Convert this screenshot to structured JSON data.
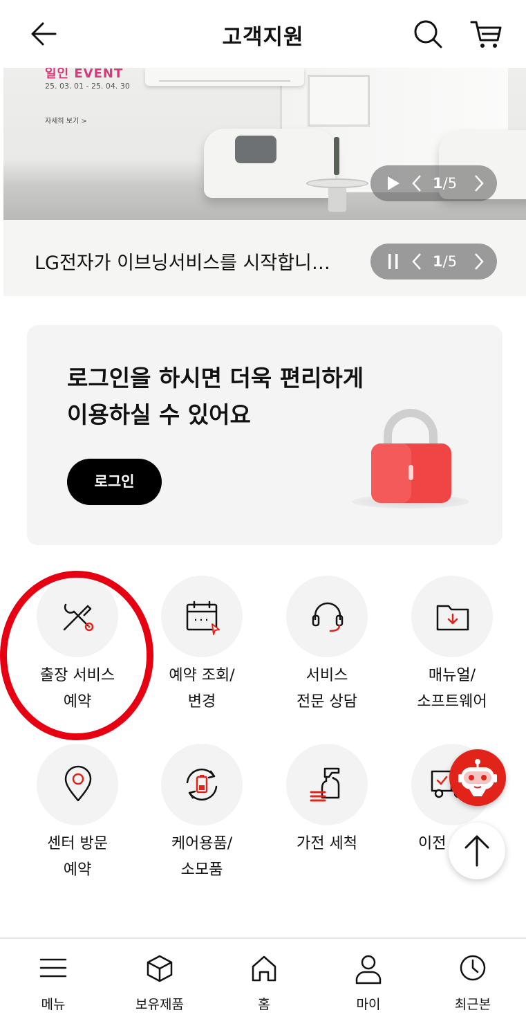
{
  "header": {
    "title": "고객지원",
    "back_icon": "arrow-left-icon",
    "search_icon": "search-icon",
    "cart_icon": "cart-icon"
  },
  "banner": {
    "promo_title": "일인 EVENT",
    "promo_date": "25. 03. 01 - 25. 04. 30",
    "promo_more": "자세히 보기 >",
    "counter_current": "1",
    "counter_sep": "/",
    "counter_total": "5"
  },
  "notice": {
    "text": "LG전자가 이브닝서비스를 시작합니…",
    "counter_current": "1",
    "counter_sep": "/",
    "counter_total": "5"
  },
  "login_card": {
    "line1": "로그인을 하시면 더욱 편리하게",
    "line2": "이용하실 수 있어요",
    "button": "로그인"
  },
  "quick_menu": [
    {
      "line1": "출장 서비스",
      "line2": "예약",
      "icon": "tools-icon"
    },
    {
      "line1": "예약 조회/",
      "line2": "변경",
      "icon": "calendar-icon"
    },
    {
      "line1": "서비스",
      "line2": "전문 상담",
      "icon": "headset-icon"
    },
    {
      "line1": "매뉴얼/",
      "line2": "소프트웨어",
      "icon": "folder-download-icon"
    },
    {
      "line1": "센터 방문",
      "line2": "예약",
      "icon": "location-pin-icon"
    },
    {
      "line1": "케어용품/",
      "line2": "소모품",
      "icon": "battery-cycle-icon"
    },
    {
      "line1": "가전 세척",
      "line2": "",
      "icon": "spray-cleaning-icon"
    },
    {
      "line1": "이전",
      "line2": "",
      "icon": "truck-icon"
    }
  ],
  "bottom_nav": [
    {
      "label": "메뉴",
      "icon": "menu-icon"
    },
    {
      "label": "보유제품",
      "icon": "box-icon"
    },
    {
      "label": "홈",
      "icon": "home-icon"
    },
    {
      "label": "마이",
      "icon": "user-icon"
    },
    {
      "label": "최근본",
      "icon": "clock-icon"
    }
  ],
  "colors": {
    "accent": "#e2231a",
    "highlight_ring": "#e60012",
    "dark": "#000000"
  }
}
